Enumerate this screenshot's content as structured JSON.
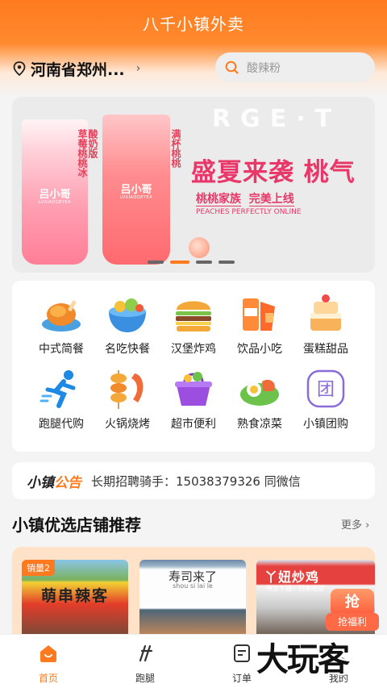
{
  "app": {
    "title": "八千小镇外卖"
  },
  "location": {
    "text": "河南省郑州...",
    "arrow": "›"
  },
  "search": {
    "placeholder": "酸辣粉"
  },
  "banner": {
    "cup_brand_1": "吕小哥",
    "cup_sub_1": "LVXIAOGEYEA",
    "cup_brand_2": "吕小哥",
    "cup_sub_2": "LVXIAOGEYEA",
    "cup1_label_a": "草莓桃桃冰",
    "cup1_label_b": "酸奶版",
    "cup2_label": "满杯桃桃",
    "bg_text": "RGE·T",
    "headline": "盛夏来袭 桃气",
    "sub_a": "桃桃家族",
    "sub_b": "完美上线",
    "sub_en": "PEACHES PERFECTLY ONLINE",
    "active_dot": 1,
    "dot_count": 4
  },
  "categories": [
    {
      "label": "中式简餐",
      "icon": "roast-chicken-icon"
    },
    {
      "label": "名吃快餐",
      "icon": "noodle-bowl-icon"
    },
    {
      "label": "汉堡炸鸡",
      "icon": "burger-icon"
    },
    {
      "label": "饮品小吃",
      "icon": "drink-cup-icon"
    },
    {
      "label": "蛋糕甜品",
      "icon": "cake-icon"
    },
    {
      "label": "跑腿代购",
      "icon": "runner-icon"
    },
    {
      "label": "火锅烧烤",
      "icon": "skewer-icon"
    },
    {
      "label": "超市便利",
      "icon": "shopping-basket-icon"
    },
    {
      "label": "熟食凉菜",
      "icon": "deli-plate-icon"
    },
    {
      "label": "小镇团购",
      "icon": "group-buy-icon"
    }
  ],
  "notice": {
    "brand_a": "小镇",
    "brand_b": "公告",
    "text": "长期招聘骑手：15038379326 同微信"
  },
  "section": {
    "title": "小镇优选店铺推荐",
    "more": "更多 ›"
  },
  "shops": [
    {
      "tag": "销量2",
      "sign": "萌串辣客"
    },
    {
      "sign": "寿司来了",
      "sub": "shou si lai le"
    },
    {
      "sign": "丫妞炒鸡",
      "sub": "带上丫妞，回家吃饭"
    }
  ],
  "promo": {
    "top": "抢",
    "bottom": "抢福利"
  },
  "tabs": [
    {
      "label": "首页",
      "icon": "home-icon",
      "active": true
    },
    {
      "label": "跑腿",
      "icon": "errand-icon",
      "active": false
    },
    {
      "label": "订单",
      "icon": "order-icon",
      "active": false
    },
    {
      "label": "我的",
      "icon": "profile-icon",
      "active": false
    }
  ],
  "watermark": "大玩客",
  "colors": {
    "accent": "#ff7a1e",
    "banner_pink": "#e8386a"
  }
}
